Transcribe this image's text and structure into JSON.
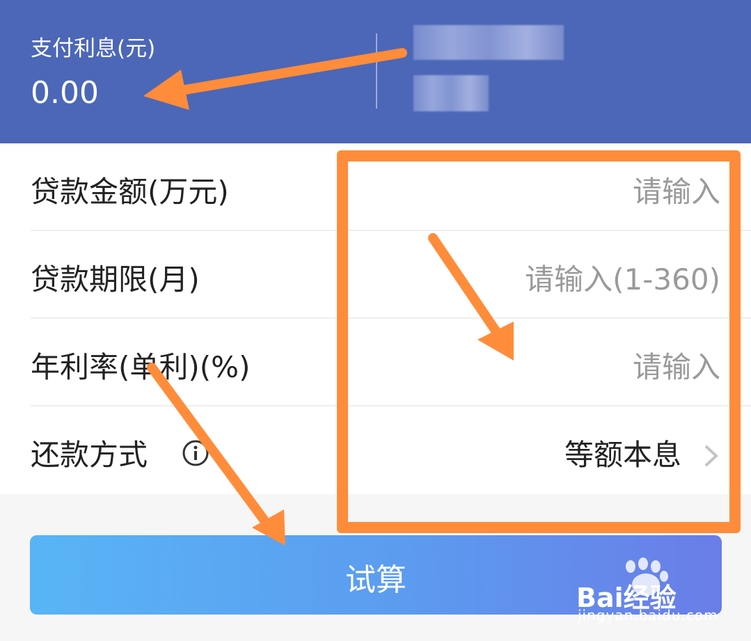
{
  "header": {
    "interest_label": "支付利息(元)",
    "interest_value": "0.00"
  },
  "form": {
    "rows": [
      {
        "label": "贷款金额(万元)",
        "placeholder": "请输入"
      },
      {
        "label": "贷款期限(月)",
        "placeholder": "请输入(1-360)"
      },
      {
        "label": "年利率(单利)(%)",
        "placeholder": "请输入"
      },
      {
        "label": "还款方式",
        "value": "等额本息"
      }
    ]
  },
  "button": {
    "calculate_label": "试算"
  },
  "watermark": {
    "brand": "Bai经验",
    "url": "jingyan.baidu.com"
  },
  "colors": {
    "header_bg": "#4c67b7",
    "annotation": "#ff8c3a",
    "button_start": "#58b5f5",
    "button_end": "#6a7de8"
  }
}
